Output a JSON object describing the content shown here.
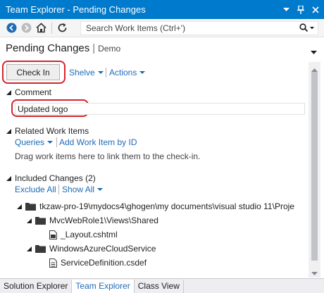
{
  "window": {
    "title": "Team Explorer - Pending Changes"
  },
  "toolbar": {
    "search_placeholder": "Search Work Items (Ctrl+')"
  },
  "header": {
    "title": "Pending Changes",
    "separator": "|",
    "context": "Demo"
  },
  "actions": {
    "check_in": "Check In",
    "shelve": "Shelve",
    "actions": "Actions"
  },
  "comment": {
    "heading": "Comment",
    "value": "Updated logo"
  },
  "related": {
    "heading": "Related Work Items",
    "queries": "Queries",
    "add_by_id": "Add Work Item by ID",
    "hint": "Drag work items here to link them to the check-in."
  },
  "included": {
    "heading": "Included Changes (2)",
    "exclude_all": "Exclude All",
    "show_all": "Show All",
    "tree": [
      {
        "label": "tkzaw-pro-19\\mydocs4\\ghogen\\my documents\\visual studio 11\\Proje",
        "kind": "folder"
      },
      {
        "label": "MvcWebRole1\\Views\\Shared",
        "kind": "folder"
      },
      {
        "label": "_Layout.cshtml",
        "kind": "file"
      },
      {
        "label": "WindowsAzureCloudService",
        "kind": "folder"
      },
      {
        "label": "ServiceDefinition.csdef",
        "kind": "file"
      }
    ]
  },
  "tabs": [
    "Solution Explorer",
    "Team Explorer",
    "Class View"
  ],
  "colors": {
    "accent": "#007acc",
    "link": "#1e6bb8",
    "highlight": "#d4242c"
  }
}
